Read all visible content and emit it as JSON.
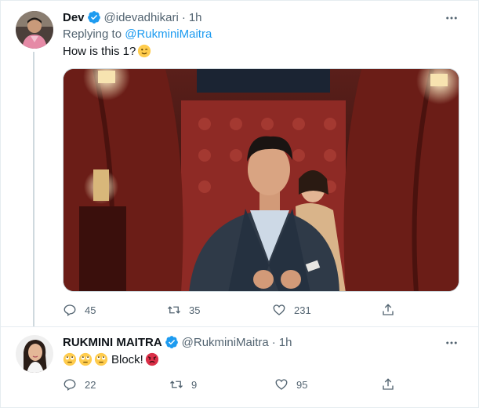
{
  "colors": {
    "accent": "#1d9bf0",
    "muted": "#536471",
    "text": "#0f1419",
    "border": "#e6ecf0"
  },
  "tweet1": {
    "name": "Dev",
    "handle": "@idevadhikari",
    "separator": "·",
    "time": "1h",
    "replying_prefix": "Replying to ",
    "replying_to": "@RukminiMaitra",
    "text": "How is this 1?",
    "emoji": "winking-face",
    "actions": {
      "replies": "45",
      "retweets": "35",
      "likes": "231"
    }
  },
  "tweet2": {
    "name": "RUKMINI MAITRA",
    "handle": "@RukminiMaitra",
    "separator": "·",
    "time": "1h",
    "text": "Block!",
    "emojis": [
      "face-with-rolling-eyes",
      "face-with-rolling-eyes",
      "face-with-rolling-eyes",
      "angry-face"
    ],
    "actions": {
      "replies": "22",
      "retweets": "9",
      "likes": "95"
    }
  },
  "icons": {
    "verified": "verified-badge-icon",
    "more": "more-icon",
    "reply": "reply-icon",
    "retweet": "retweet-icon",
    "like": "heart-icon",
    "share": "share-icon"
  }
}
